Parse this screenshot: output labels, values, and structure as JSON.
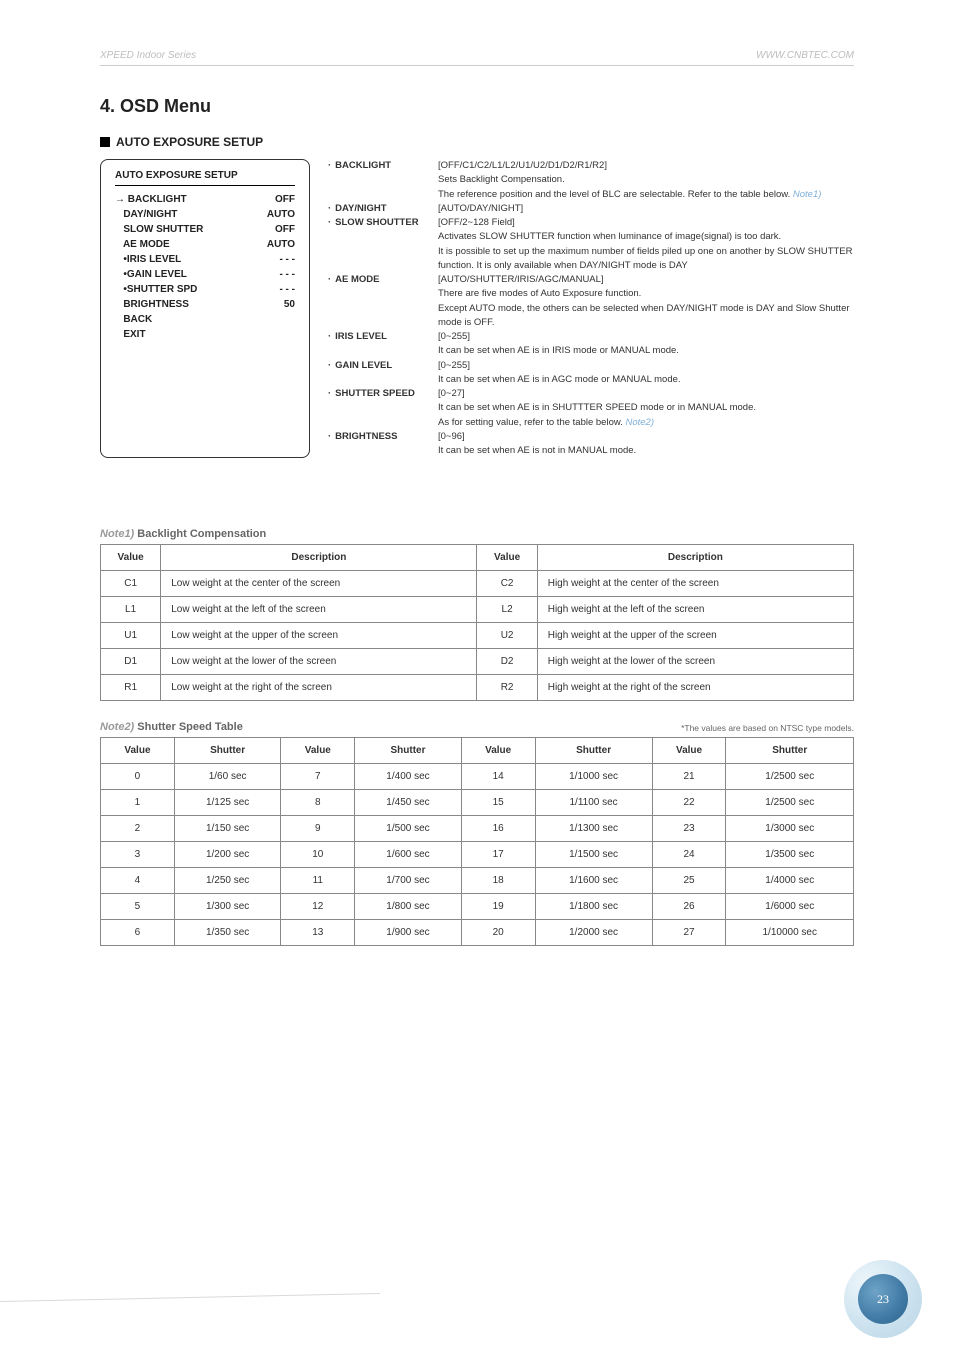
{
  "header": {
    "left": "XPEED Indoor Series",
    "right": "WWW.CNBTEC.COM"
  },
  "title": "4. OSD Menu",
  "sub": "AUTO EXPOSURE SETUP",
  "osd": {
    "title": "AUTO EXPOSURE SETUP",
    "rows": [
      {
        "k": "→ BACKLIGHT",
        "v": "OFF"
      },
      {
        "k": "   DAY/NIGHT",
        "v": "AUTO"
      },
      {
        "k": "   SLOW SHUTTER",
        "v": "OFF"
      },
      {
        "k": "   AE MODE",
        "v": "AUTO"
      },
      {
        "k": "   •IRIS LEVEL",
        "v": "- - -"
      },
      {
        "k": "   •GAIN LEVEL",
        "v": "- - -"
      },
      {
        "k": "   •SHUTTER SPD",
        "v": "- - -"
      },
      {
        "k": "   BRIGHTNESS",
        "v": "50"
      },
      {
        "k": "   BACK",
        "v": ""
      },
      {
        "k": "   EXIT",
        "v": ""
      }
    ]
  },
  "desc": {
    "backlight": {
      "label": "BACKLIGHT",
      "range": "[OFF/C1/C2/L1/L2/U1/U2/D1/D2/R1/R2]",
      "l1": "Sets Backlight Compensation.",
      "l2a": "The reference position and the level of BLC are selectable. Refer to the table below. ",
      "note": "Note1)"
    },
    "daynight": {
      "label": "DAY/NIGHT",
      "range": "[AUTO/DAY/NIGHT]"
    },
    "slow": {
      "label": "SLOW SHOUTTER",
      "range": "[OFF/2~128 Field]",
      "l1": "Activates SLOW SHUTTER function when luminance of image(signal) is too dark.",
      "l2": "It is possible to set up the maximum number of fields piled up one on another by SLOW SHUTTER function. It is only available when DAY/NIGHT mode is DAY"
    },
    "ae": {
      "label": "AE MODE",
      "range": "[AUTO/SHUTTER/IRIS/AGC/MANUAL]",
      "l1": "There are five modes of Auto Exposure function.",
      "l2": "Except AUTO mode, the others can be selected when DAY/NIGHT mode is DAY and Slow Shutter mode is OFF."
    },
    "iris": {
      "label": "IRIS LEVEL",
      "range": "[0~255]",
      "l1": "It can be set when AE is in IRIS mode or MANUAL mode."
    },
    "gain": {
      "label": "GAIN LEVEL",
      "range": "[0~255]",
      "l1": "It can be set when AE is in AGC mode or MANUAL mode."
    },
    "shutter": {
      "label": "SHUTTER SPEED",
      "range": "[0~27]",
      "l1": "It can be set when AE is in SHUTTTER SPEED mode or in MANUAL mode.",
      "l2a": "As for setting value, refer to the table below. ",
      "note": "Note2)"
    },
    "bright": {
      "label": "BRIGHTNESS",
      "range": "[0~96]",
      "l1": "It can be set when AE is not in MANUAL mode."
    }
  },
  "note1": {
    "titleEm": "Note1)",
    "titleRest": " Backlight Compensation",
    "head": {
      "v": "Value",
      "d": "Description"
    },
    "rows": [
      {
        "a": "C1",
        "ad": "Low weight at the center of the screen",
        "b": "C2",
        "bd": "High weight at the center of the screen"
      },
      {
        "a": "L1",
        "ad": "Low weight at the left of the screen",
        "b": "L2",
        "bd": "High weight at the left of the screen"
      },
      {
        "a": "U1",
        "ad": "Low weight at the upper of the screen",
        "b": "U2",
        "bd": "High weight at the upper of the screen"
      },
      {
        "a": "D1",
        "ad": "Low weight at the lower of the screen",
        "b": "D2",
        "bd": "High weight at the lower of the screen"
      },
      {
        "a": "R1",
        "ad": "Low weight at the right of the screen",
        "b": "R2",
        "bd": "High weight at the right of the screen"
      }
    ]
  },
  "note2": {
    "titleEm": "Note2)",
    "titleRest": " Shutter Speed Table",
    "aside": "*The values are based on NTSC type models.",
    "head": {
      "v": "Value",
      "s": "Shutter"
    },
    "rows": [
      {
        "c0": "0",
        "c1": "1/60 sec",
        "c2": "7",
        "c3": "1/400 sec",
        "c4": "14",
        "c5": "1/1000 sec",
        "c6": "21",
        "c7": "1/2500 sec"
      },
      {
        "c0": "1",
        "c1": "1/125 sec",
        "c2": "8",
        "c3": "1/450 sec",
        "c4": "15",
        "c5": "1/1100 sec",
        "c6": "22",
        "c7": "1/2500 sec"
      },
      {
        "c0": "2",
        "c1": "1/150 sec",
        "c2": "9",
        "c3": "1/500 sec",
        "c4": "16",
        "c5": "1/1300 sec",
        "c6": "23",
        "c7": "1/3000 sec"
      },
      {
        "c0": "3",
        "c1": "1/200 sec",
        "c2": "10",
        "c3": "1/600 sec",
        "c4": "17",
        "c5": "1/1500 sec",
        "c6": "24",
        "c7": "1/3500 sec"
      },
      {
        "c0": "4",
        "c1": "1/250 sec",
        "c2": "11",
        "c3": "1/700 sec",
        "c4": "18",
        "c5": "1/1600 sec",
        "c6": "25",
        "c7": "1/4000 sec"
      },
      {
        "c0": "5",
        "c1": "1/300 sec",
        "c2": "12",
        "c3": "1/800 sec",
        "c4": "19",
        "c5": "1/1800 sec",
        "c6": "26",
        "c7": "1/6000 sec"
      },
      {
        "c0": "6",
        "c1": "1/350 sec",
        "c2": "13",
        "c3": "1/900 sec",
        "c4": "20",
        "c5": "1/2000 sec",
        "c6": "27",
        "c7": "1/10000 sec"
      }
    ]
  },
  "pageNum": "23"
}
